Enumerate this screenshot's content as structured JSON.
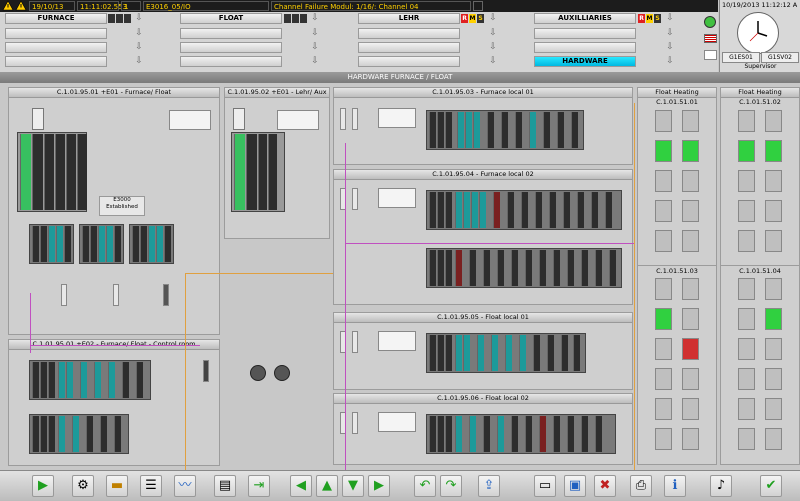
{
  "alarm": {
    "date": "19/10/13",
    "time": "11:11:02.553",
    "count": "1",
    "source": "E3016_05/IO",
    "message": "Channel  Failure Modul: 1/16/: Channel 04"
  },
  "areas": [
    {
      "name": "FURNACE"
    },
    {
      "name": "FLOAT"
    },
    {
      "name": "LEHR"
    },
    {
      "name": "AUXILLIARIES"
    }
  ],
  "rms": {
    "r": "R",
    "m": "M",
    "s": "S"
  },
  "hardware_button": "HARDWARE",
  "clock": {
    "datetime": "10/19/2013 11:12:12 A",
    "server1": "G1ES01",
    "server2": "G1SV02",
    "user": "Supervisor"
  },
  "screen_title": "HARDWARE FURNACE / FLOAT",
  "panels": [
    {
      "title": "C.1.01.95.01 +E01  -  Furnace/ Float"
    },
    {
      "title": "C.1.01.95.02 +E01  -  Lehr/ Aux"
    },
    {
      "title": "C.1.01.95.03  -  Furnace local 01"
    },
    {
      "title": "C.1.01.95.04  -  Furnace local 02"
    },
    {
      "title": "C.1.01.95.01 +E02  -  Furnace/ Float - Control room"
    },
    {
      "title": "C.1.01.95.05  -  Float local 01"
    },
    {
      "title": "C.1.01.95.06  -  Float local 02"
    }
  ],
  "server_label": "E3000",
  "server_status": "Established",
  "float_heating": [
    {
      "heading": "Float Heating",
      "id": "C.1.01.51.01"
    },
    {
      "heading": "Float Heating",
      "id": "C.1.01.51.02"
    },
    {
      "id": "C.1.01.51.03"
    },
    {
      "id": "C.1.01.51.04"
    }
  ],
  "toolbar_icons": [
    "play-icon",
    "settings-icon",
    "folder-icon",
    "list-icon",
    "trend-icon",
    "report-icon",
    "export-icon",
    "back-icon",
    "up-icon",
    "down-icon",
    "forward-icon",
    "undo-icon",
    "redo-icon",
    "open-icon",
    "save-icon",
    "close-icon",
    "print-icon",
    "info-icon",
    "audio-icon",
    "check-icon"
  ]
}
